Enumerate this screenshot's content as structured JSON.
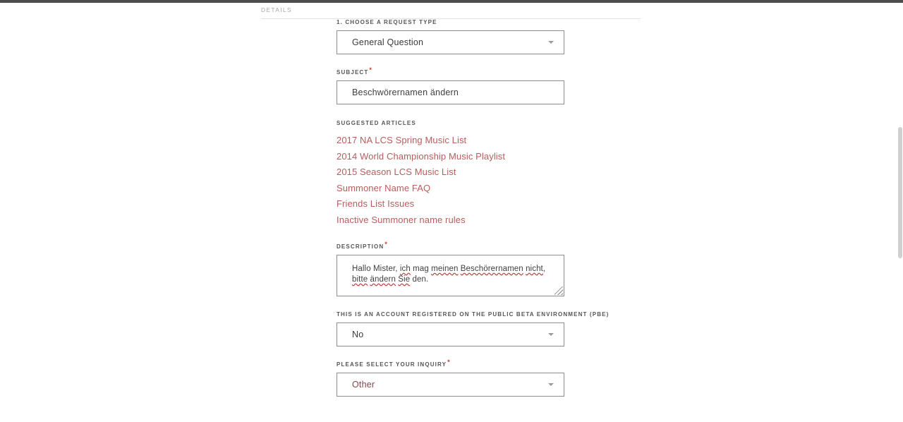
{
  "section": {
    "header_title": "DETAILS"
  },
  "form": {
    "request_type": {
      "label": "1. CHOOSE A REQUEST TYPE",
      "value": "General Question",
      "required": false,
      "caret_icon": "chevron-down-icon"
    },
    "subject": {
      "label": "SUBJECT",
      "value": "Beschwörernamen ändern",
      "required": true,
      "required_marker": "*"
    },
    "suggested_articles": {
      "label": "SUGGESTED ARTICLES",
      "items": [
        "2017 NA LCS Spring Music List",
        "2014 World Championship Music Playlist",
        "2015 Season LCS Music List",
        "Summoner Name FAQ",
        "Friends List Issues",
        "Inactive Summoner name rules"
      ]
    },
    "description": {
      "label": "DESCRIPTION",
      "required": true,
      "required_marker": "*",
      "line1_part1": "Hallo Mister, ",
      "line1_misspelled1": "ich",
      "line1_part2": " mag ",
      "line1_misspelled2": "meinen",
      "line1_part3": " ",
      "line1_misspelled3": "Beschörernamen",
      "line1_part4": " ",
      "line1_misspelled4": "nicht",
      "line1_part5": ",",
      "line2_misspelled1": "bitte",
      "line2_part1": " ",
      "line2_misspelled2": "ändern",
      "line2_part2": " ",
      "line2_misspelled3": "Sie",
      "line2_part3": " den.",
      "resize_handle": "resize-grip-icon"
    },
    "pbe": {
      "label": "THIS IS AN ACCOUNT REGISTERED ON THE PUBLIC BETA ENVIRONMENT (PBE)",
      "value": "No",
      "required": false,
      "caret_icon": "chevron-down-icon"
    },
    "inquiry": {
      "label": "PLEASE SELECT YOUR INQUIRY",
      "value": "Other",
      "required": true,
      "required_marker": "*",
      "caret_icon": "chevron-down-icon"
    }
  },
  "colors": {
    "link": "#b85c5c",
    "accent_value": "#7d4a4a",
    "required_marker": "#c0392b",
    "border": "#8d8d8d",
    "top_bar": "#4d4d4d"
  }
}
